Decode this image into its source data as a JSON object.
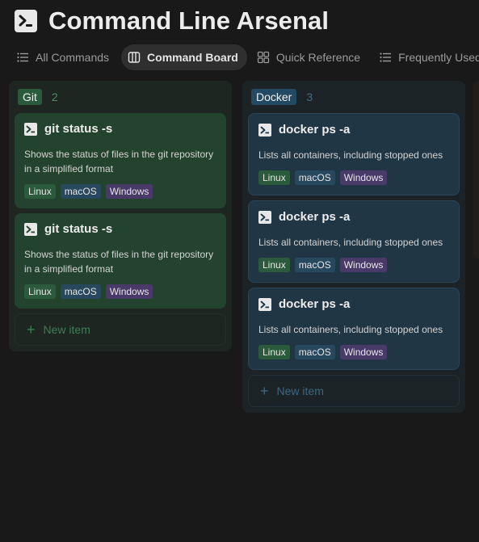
{
  "page": {
    "title": "Command Line Arsenal",
    "icon": "terminal-icon"
  },
  "tabs": [
    {
      "label": "All Commands",
      "icon": "list-icon",
      "active": false
    },
    {
      "label": "Command Board",
      "icon": "board-icon",
      "active": true
    },
    {
      "label": "Quick Reference",
      "icon": "grid-icon",
      "active": false
    },
    {
      "label": "Frequently Used",
      "icon": "list-icon",
      "active": false
    }
  ],
  "colors": {
    "background": "#191919",
    "git_column": "#1d2620",
    "git_card": "#24432f",
    "docker_column": "#1c2326",
    "docker_card": "#213645",
    "tag_linux": "#2b5a3c",
    "tag_macos": "#28485e",
    "tag_windows": "#4a3a6a"
  },
  "board": {
    "columns": [
      {
        "name": "Git",
        "count": "2",
        "cards": [
          {
            "title": "git status -s",
            "description": "Shows the status of files in the git repository in a simplified format",
            "tags": [
              "Linux",
              "macOS",
              "Windows"
            ]
          },
          {
            "title": "git status -s",
            "description": "Shows the status of files in the git repository in a simplified format",
            "tags": [
              "Linux",
              "macOS",
              "Windows"
            ]
          }
        ],
        "new_item_label": "New item"
      },
      {
        "name": "Docker",
        "count": "3",
        "cards": [
          {
            "title": "docker ps -a",
            "description": "Lists all containers, including stopped ones",
            "tags": [
              "Linux",
              "macOS",
              "Windows"
            ]
          },
          {
            "title": "docker ps -a",
            "description": "Lists all containers, including stopped ones",
            "tags": [
              "Linux",
              "macOS",
              "Windows"
            ]
          },
          {
            "title": "docker ps -a",
            "description": "Lists all containers, including stopped ones",
            "tags": [
              "Linux",
              "macOS",
              "Windows"
            ]
          }
        ],
        "new_item_label": "New item"
      }
    ]
  }
}
